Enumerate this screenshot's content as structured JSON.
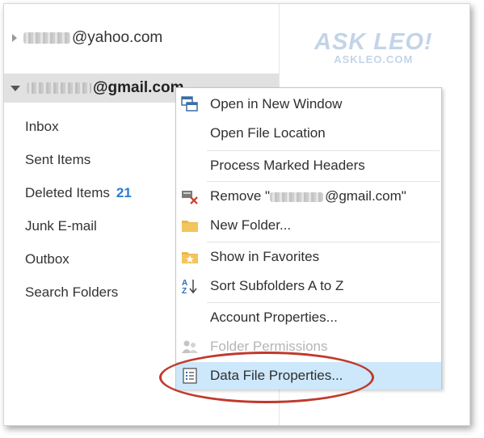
{
  "accounts": {
    "yahoo": "@yahoo.com",
    "gmail": "@gmail.com"
  },
  "folders": [
    {
      "label": "Inbox"
    },
    {
      "label": "Sent Items"
    },
    {
      "label": "Deleted Items",
      "count": "21"
    },
    {
      "label": "Junk E-mail"
    },
    {
      "label": "Outbox"
    },
    {
      "label": "Search Folders"
    }
  ],
  "logo": {
    "title": "ASK LEO!",
    "site": "ASKLEO.COM"
  },
  "menu": {
    "items": [
      {
        "label": "Open in New Window",
        "icon": "new-window-icon"
      },
      {
        "label": "Open File Location",
        "icon": ""
      },
      {
        "label": "Process Marked Headers",
        "icon": ""
      },
      {
        "label_prefix": "Remove \"",
        "label_suffix": "@gmail.com\"",
        "icon": "remove-account-icon"
      },
      {
        "label": "New Folder...",
        "icon": "folder-icon"
      },
      {
        "label": "Show in Favorites",
        "icon": "favorite-folder-icon"
      },
      {
        "label": "Sort Subfolders A to Z",
        "icon": "sort-az-icon"
      },
      {
        "label": "Account Properties...",
        "icon": ""
      },
      {
        "label": "Folder Permissions",
        "icon": "permissions-icon",
        "disabled": true
      },
      {
        "label": "Data File Properties...",
        "icon": "data-file-icon",
        "highlighted": true
      }
    ]
  },
  "colors": {
    "highlight": "#cde8fb",
    "annotation": "#c0392b",
    "count": "#2b7cd3"
  }
}
